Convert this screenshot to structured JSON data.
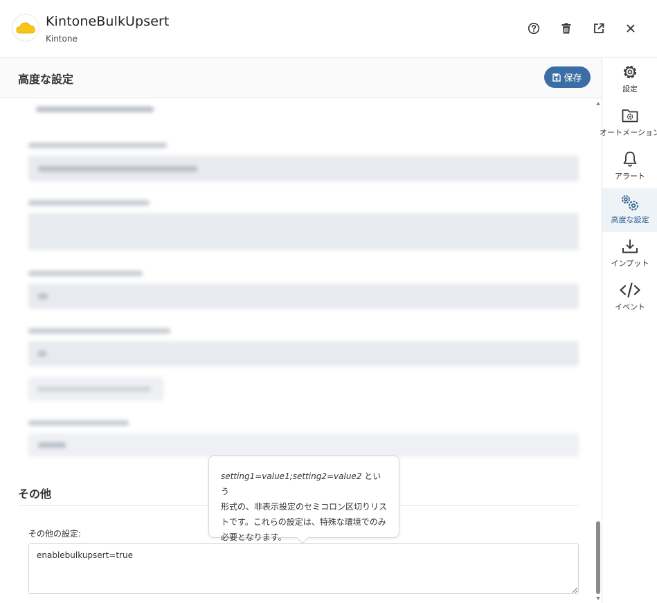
{
  "app": {
    "title": "KintoneBulkUpsert",
    "subtitle": "Kintone"
  },
  "header_buttons": [
    "help-icon",
    "trash-icon",
    "external-link-icon",
    "close-icon"
  ],
  "section": {
    "title": "高度な設定",
    "save_label": "保存"
  },
  "other": {
    "title": "その他",
    "field_label": "その他の設定:",
    "value": "enablebulkupsert=true"
  },
  "tooltip": {
    "code": "setting1=value1;setting2=value2",
    "line1_rest": " という",
    "line2": "形式の、非表示設定のセミコロン区切りリス",
    "line3": "トです。これらの設定は、特殊な環境でのみ",
    "line4": "必要となります。"
  },
  "nav": {
    "items": [
      {
        "label": "設定",
        "icon": "gear-icon"
      },
      {
        "label": "オートメーション",
        "icon": "folder-gear-icon"
      },
      {
        "label": "アラート",
        "icon": "bell-icon"
      },
      {
        "label": "高度な設定",
        "icon": "gears-icon"
      },
      {
        "label": "インプット",
        "icon": "download-icon"
      },
      {
        "label": "イベント",
        "icon": "code-icon"
      }
    ],
    "active": "高度な設定"
  },
  "colors": {
    "accent": "#3a6ea5",
    "active_nav_bg": "#eef3f8",
    "logo_yellow": "#f5c518"
  }
}
